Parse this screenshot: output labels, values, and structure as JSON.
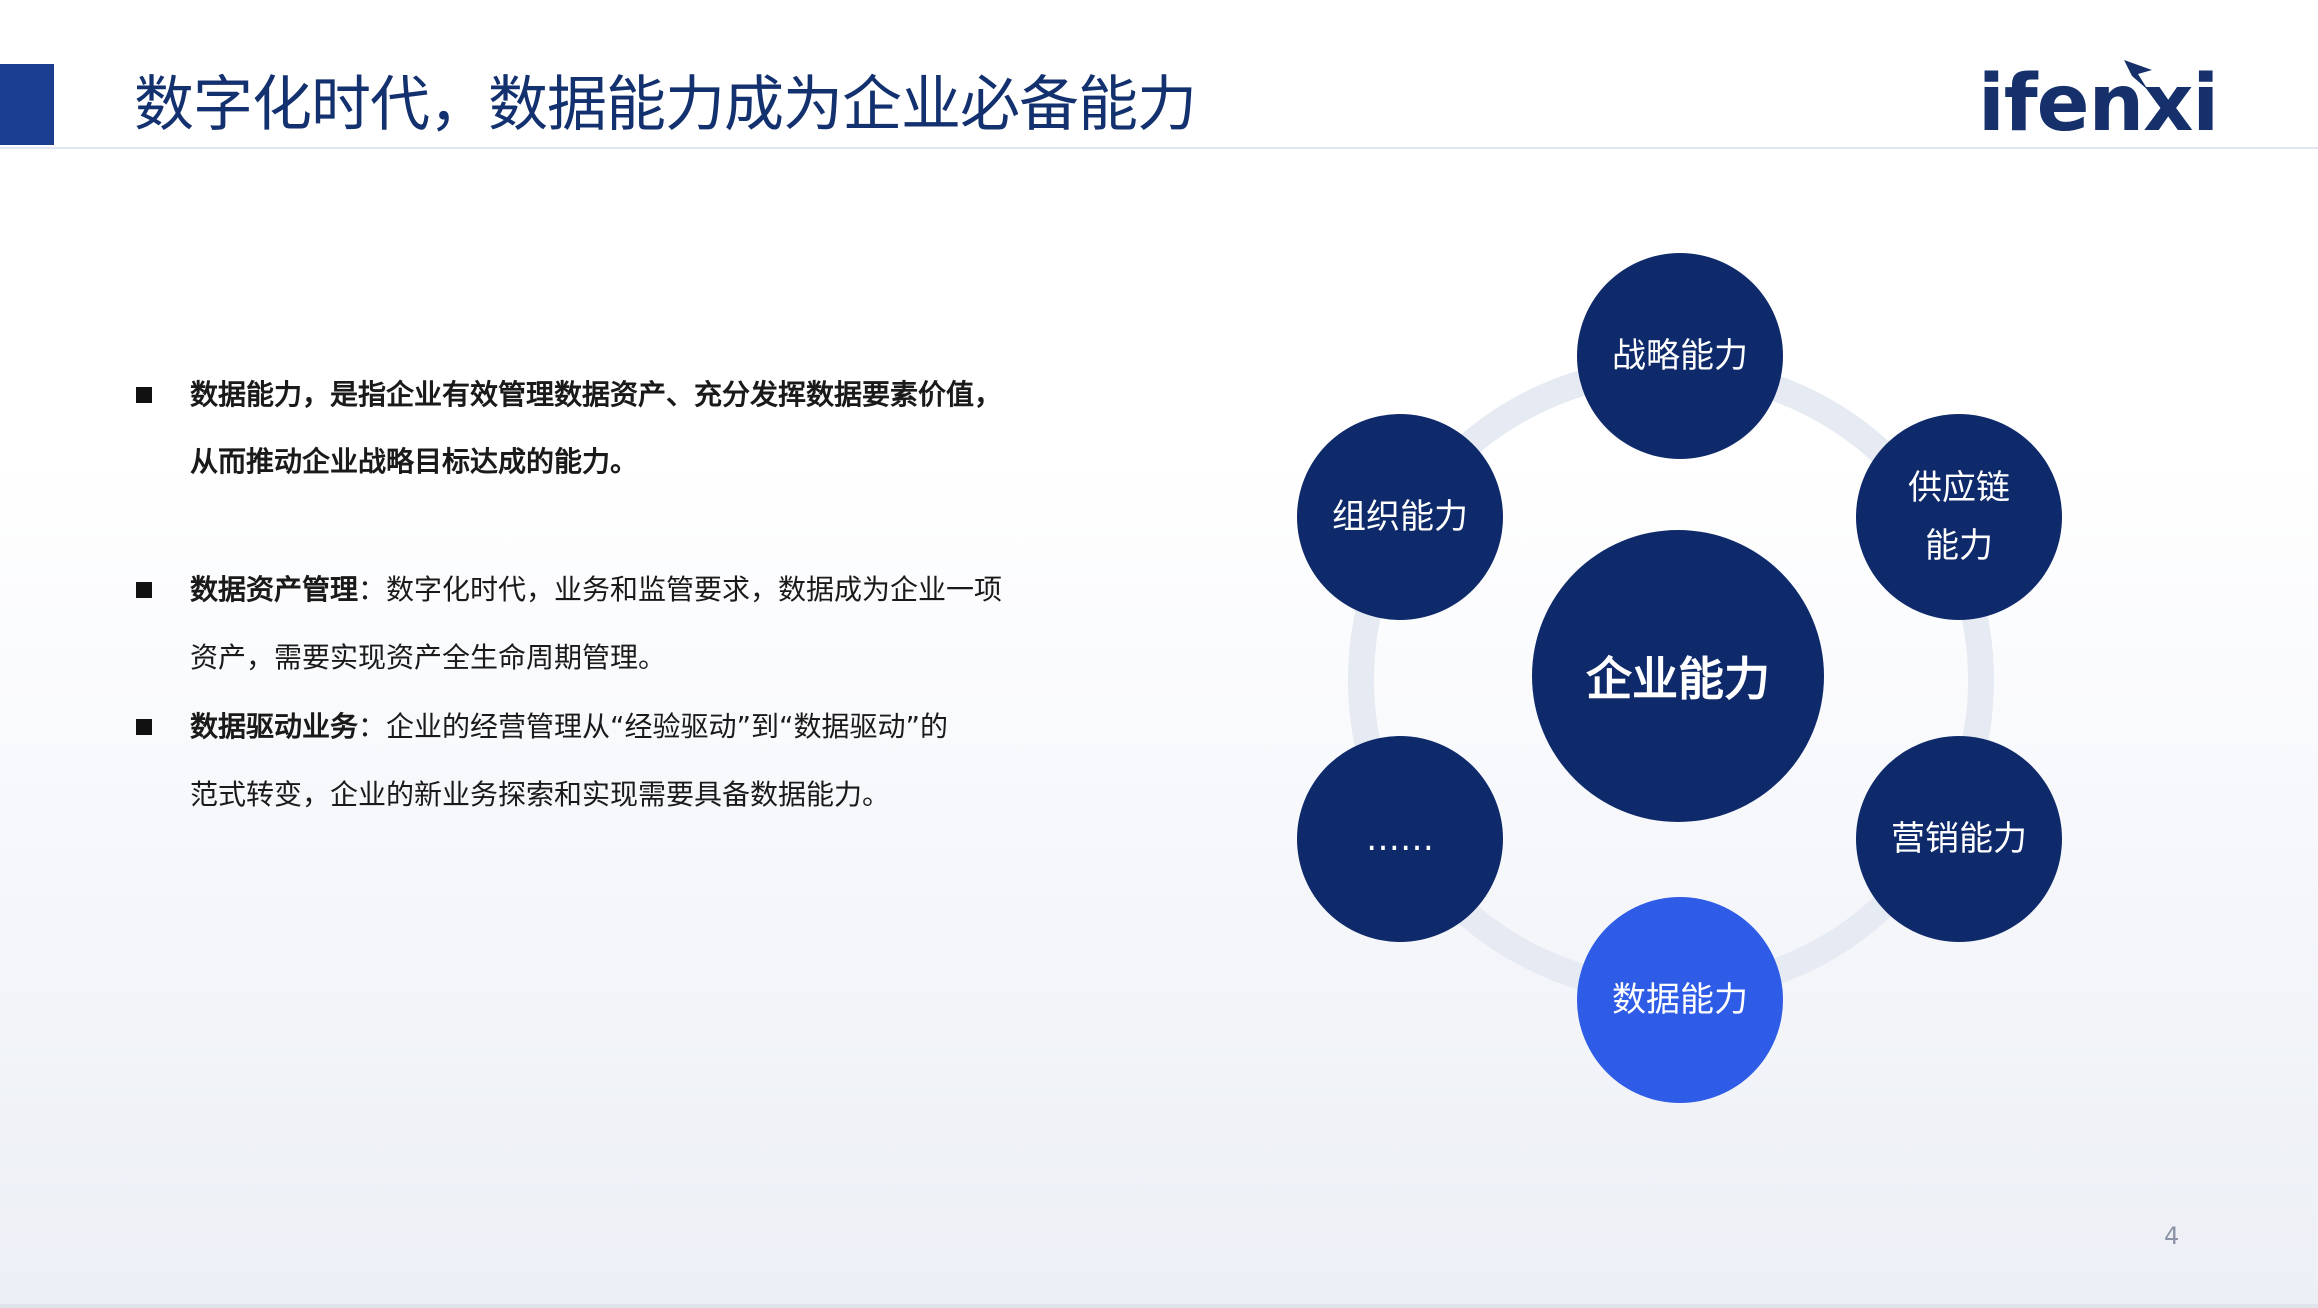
{
  "header": {
    "title": "数字化时代，数据能力成为企业必备能力",
    "logo_text": "ifenxi",
    "accent_color": "#1a3d8f"
  },
  "bullets": [
    {
      "line1_bold": "数据能力，是指企业有效管理数据资产、充分发挥数据要素价值，",
      "line2_bold": "从而推动企业战略目标达成的能力。"
    },
    {
      "term": "数据资产管理",
      "line1_rest": "：数字化时代，业务和监管要求，数据成为企业一项",
      "line2": "资产，需要实现资产全生命周期管理。"
    },
    {
      "term": "数据驱动业务",
      "line1_rest": "：企业的经营管理从“经验驱动”到“数据驱动”的",
      "line2": "范式转变，企业的新业务探索和实现需要具备数据能力。"
    }
  ],
  "diagram": {
    "center": "企业能力",
    "nodes": {
      "top": "战略能力",
      "top_right_line1": "供应链",
      "top_right_line2": "能力",
      "bottom_right": "营销能力",
      "bottom": "数据能力",
      "bottom_left": "……",
      "top_left": "组织能力"
    },
    "colors": {
      "node": "#0f2a6b",
      "highlight": "#2f5ce6",
      "ring": "#e6eaf2"
    }
  },
  "footer": {
    "page_number": "4"
  }
}
